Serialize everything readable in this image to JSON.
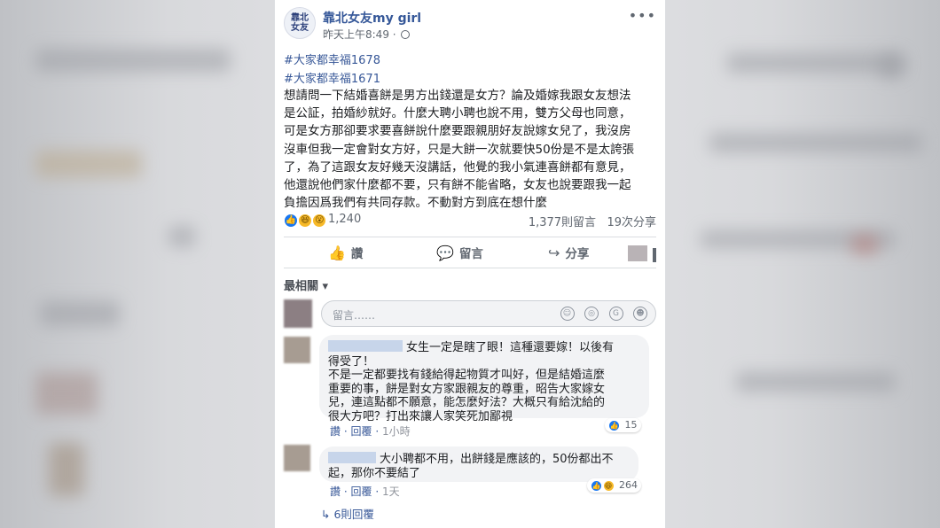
{
  "page": {
    "name": "靠北女友my girl",
    "avatar_text": "靠北\n女友",
    "timestamp": "昨天上午8:49",
    "more": "•••"
  },
  "background_hashtag": "#大家都幸福1678",
  "post": {
    "hashtag": "#大家都幸福1671",
    "body": "想請問一下結婚喜餅是男方出錢還是女方？論及婚嫁我跟女友想法\n是公証，拍婚紗就好。什麼大聘小聘也說不用，雙方父母也同意，\n可是女方那卻要求要喜餅說什麼要跟親朋好友說嫁女兒了，我沒房\n沒車但我一定會對女方好，只是大餅一次就要快50份是不是太誇張\n了，為了這跟女友好幾天沒講話，他覺的我小氣連喜餅都有意見，\n他還說他們家什麼都不要，只有餅不能省略，女友也說要跟我一起\n負擔因爲我們有共同存款。不動對方到底在想什麼",
    "reaction_count": "1,240",
    "comment_count": "1,377則留言",
    "share_count": "19次分享"
  },
  "actions": {
    "like": "讚",
    "comment": "留言",
    "share": "分享"
  },
  "sort_label": "最相關",
  "composer": {
    "placeholder": "留言……"
  },
  "comments": [
    {
      "text": "女生一定是瞎了眼！這種還要嫁！以後有\n得受了！\n不是一定都要找有錢給得起物質才叫好，但是結婚這麼\n重要的事，餅是對女方家跟親友的尊重，昭告大家嫁女\n兒，連這點都不願意，能怎麼好法？大概只有給沈給的\n很大方吧？打出來讓人家笑死加鄙視",
      "like_label": "讚",
      "reply_label": "回覆",
      "time": "1小時",
      "reaction_count": "15"
    },
    {
      "text": "大小聘都不用，出餅錢是應該的，50份都出不\n起，那你不要結了",
      "like_label": "讚",
      "reply_label": "回覆",
      "time": "1天",
      "reaction_count": "264"
    }
  ],
  "view_replies": "6則回覆",
  "colors": {
    "link": "#385898",
    "like_blue": "#1877f2",
    "card_bg": "#ffffff"
  }
}
